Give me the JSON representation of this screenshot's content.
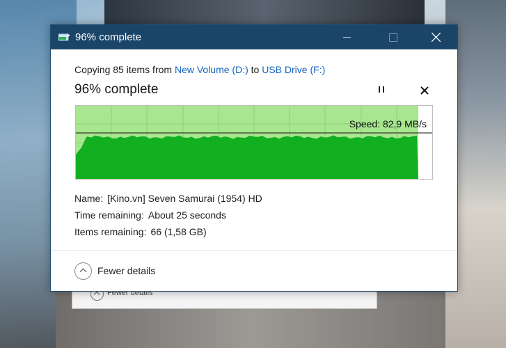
{
  "window": {
    "title": "96% complete"
  },
  "header": {
    "copy_prefix": "Copying 85 items from",
    "source": "New Volume (D:)",
    "to_word": "to",
    "destination": "USB Drive (F:)",
    "progress_label": "96% complete"
  },
  "progress": {
    "percent": 96,
    "speed_label": "Speed: 82,9 MB/s"
  },
  "details": {
    "name_label": "Name:",
    "name_value": "[Kino.vn] Seven Samurai (1954) HD",
    "time_label": "Time remaining:",
    "time_value": "About 25 seconds",
    "items_label": "Items remaining:",
    "items_value": "66 (1,58 GB)"
  },
  "footer": {
    "toggle_label": "Fewer details"
  },
  "background_dialog": {
    "toggle_label": "Fewer details"
  },
  "colors": {
    "titlebar": "#1b4568",
    "link": "#1565c0",
    "graph_done": "#a8e68f",
    "graph_fill": "#12b021"
  }
}
